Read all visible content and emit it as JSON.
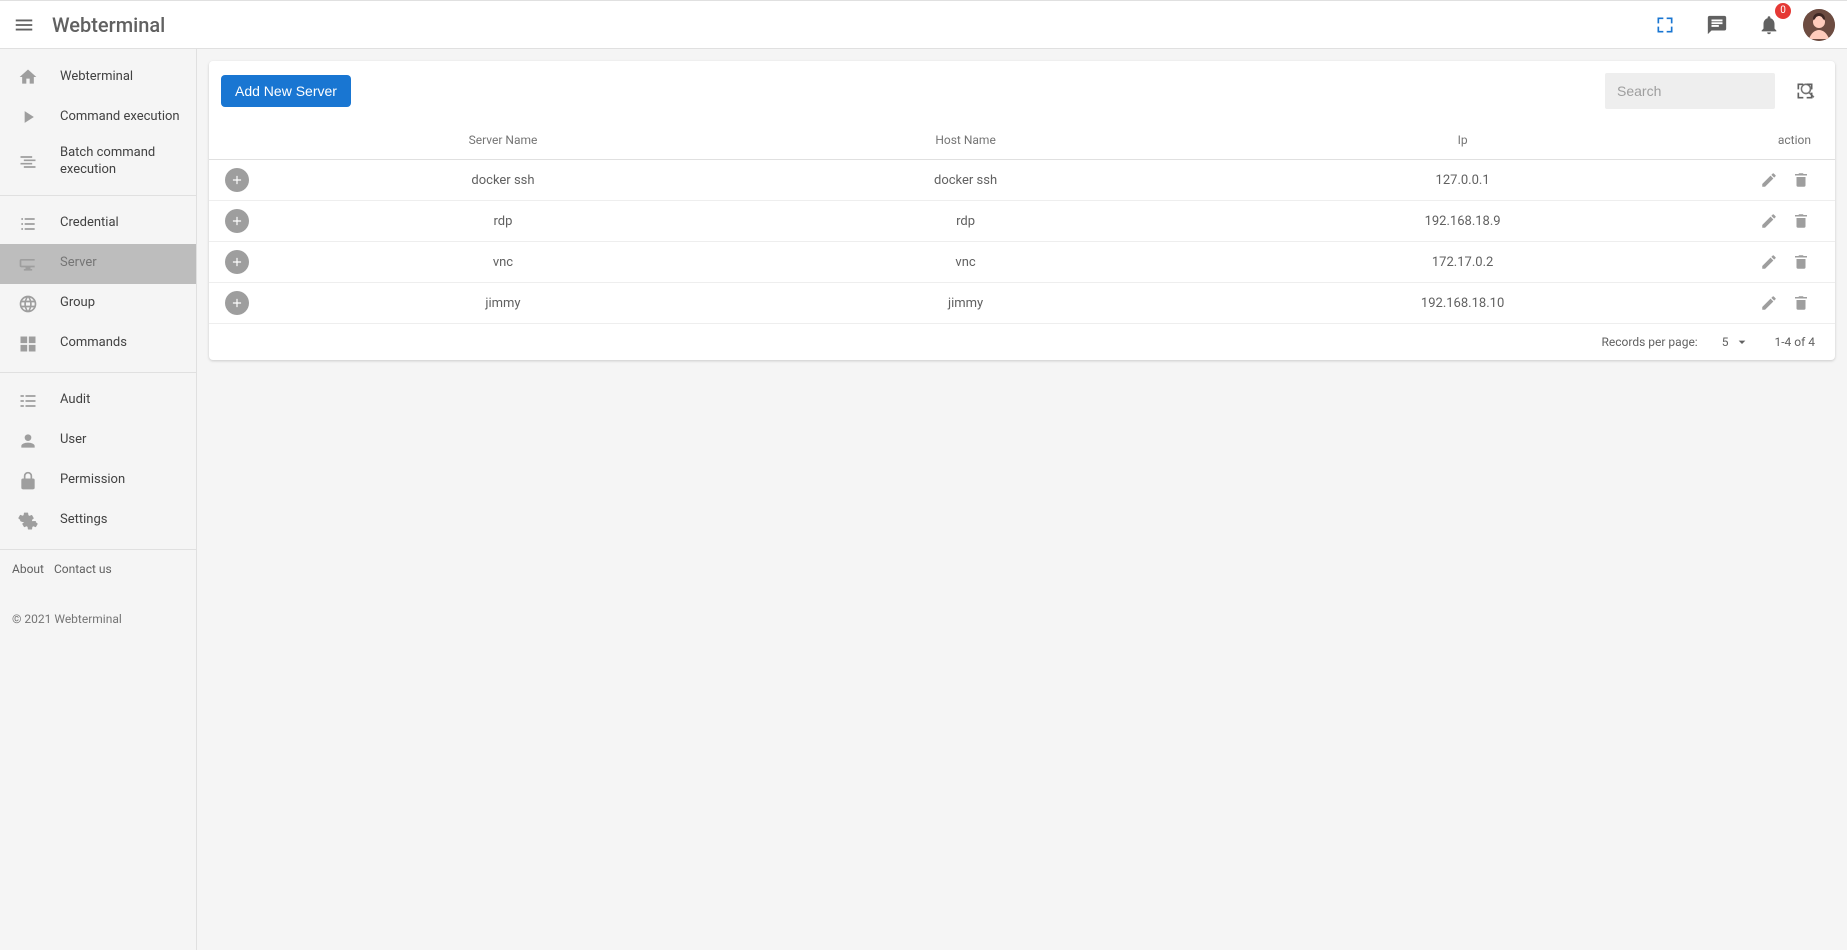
{
  "header": {
    "title": "Webterminal",
    "notification_count": "0"
  },
  "sidebar": {
    "groups": [
      {
        "items": [
          {
            "icon": "home",
            "label": "Webterminal",
            "active": false
          },
          {
            "icon": "play",
            "label": "Command execution",
            "active": false
          },
          {
            "icon": "lines",
            "label": "Batch command execution",
            "active": false
          }
        ]
      },
      {
        "items": [
          {
            "icon": "list",
            "label": "Credential",
            "active": false
          },
          {
            "icon": "devices",
            "label": "Server",
            "active": true
          },
          {
            "icon": "globe",
            "label": "Group",
            "active": false
          },
          {
            "icon": "grid",
            "label": "Commands",
            "active": false
          }
        ]
      },
      {
        "items": [
          {
            "icon": "bars",
            "label": "Audit",
            "active": false
          },
          {
            "icon": "person",
            "label": "User",
            "active": false
          },
          {
            "icon": "lock",
            "label": "Permission",
            "active": false
          },
          {
            "icon": "gear",
            "label": "Settings",
            "active": false
          }
        ]
      }
    ],
    "footer_links": [
      "About",
      "Contact us"
    ],
    "copyright": "© 2021 Webterminal"
  },
  "toolbar": {
    "add_button_label": "Add New Server",
    "search_placeholder": "Search"
  },
  "table": {
    "columns": [
      "Server Name",
      "Host Name",
      "Ip",
      "action"
    ],
    "rows": [
      {
        "server_name": "docker ssh",
        "host_name": "docker ssh",
        "ip": "127.0.0.1"
      },
      {
        "server_name": "rdp",
        "host_name": "rdp",
        "ip": "192.168.18.9"
      },
      {
        "server_name": "vnc",
        "host_name": "vnc",
        "ip": "172.17.0.2"
      },
      {
        "server_name": "jimmy",
        "host_name": "jimmy",
        "ip": "192.168.18.10"
      }
    ],
    "pagination": {
      "label": "Records per page:",
      "page_size": "5",
      "range_text": "1-4 of 4"
    }
  }
}
